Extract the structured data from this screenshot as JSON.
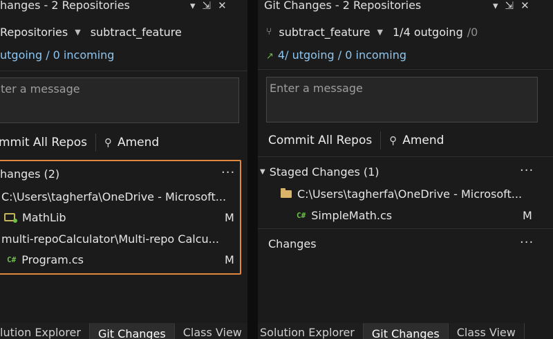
{
  "left": {
    "title": "hanges - 2 Repositories",
    "controls": [
      "▾",
      "⇲",
      "✕"
    ],
    "repos_label": "Repositories",
    "branch": "subtract_feature",
    "sync": "utgoing / 0 incoming",
    "message_placeholder": "ter a message",
    "commit_all": "mmit All Repos",
    "amend": "Amend",
    "changes_header": "hanges (2)",
    "more": "···",
    "repo_path_1": "C:\\Users\\tagherfa\\OneDrive - Microsoft...",
    "repo_1": "MathLib",
    "repo_1_status": "M",
    "repo_path_2": "multi-repoCalculator\\Multi-repo Calcu...",
    "file_2": "Program.cs",
    "file_2_status": "M",
    "tabs": [
      "lution Explorer",
      "Git Changes",
      "Class View"
    ]
  },
  "right": {
    "title": "Git Changes - 2 Repositories",
    "controls": [
      "▾",
      "⇲",
      "✕"
    ],
    "branch": "subtract_feature",
    "outgoing": "1/4 outgoing",
    "outgoing_extra": "/0",
    "sync": "4/ utgoing / 0 incoming",
    "message_placeholder": "Enter a message",
    "commit_all": "Commit All Repos",
    "amend": "Amend",
    "staged_header": "Staged Changes (1)",
    "more": "···",
    "staged_path": "C:\\Users\\tagherfa\\OneDrive - Microsoft...",
    "staged_file": "SimpleMath.cs",
    "staged_status": "M",
    "changes_header": "Changes",
    "tabs": [
      "Solution Explorer",
      "Git Changes",
      "Class View"
    ]
  },
  "icons": {
    "csharp": "C#",
    "search": "⚲"
  }
}
